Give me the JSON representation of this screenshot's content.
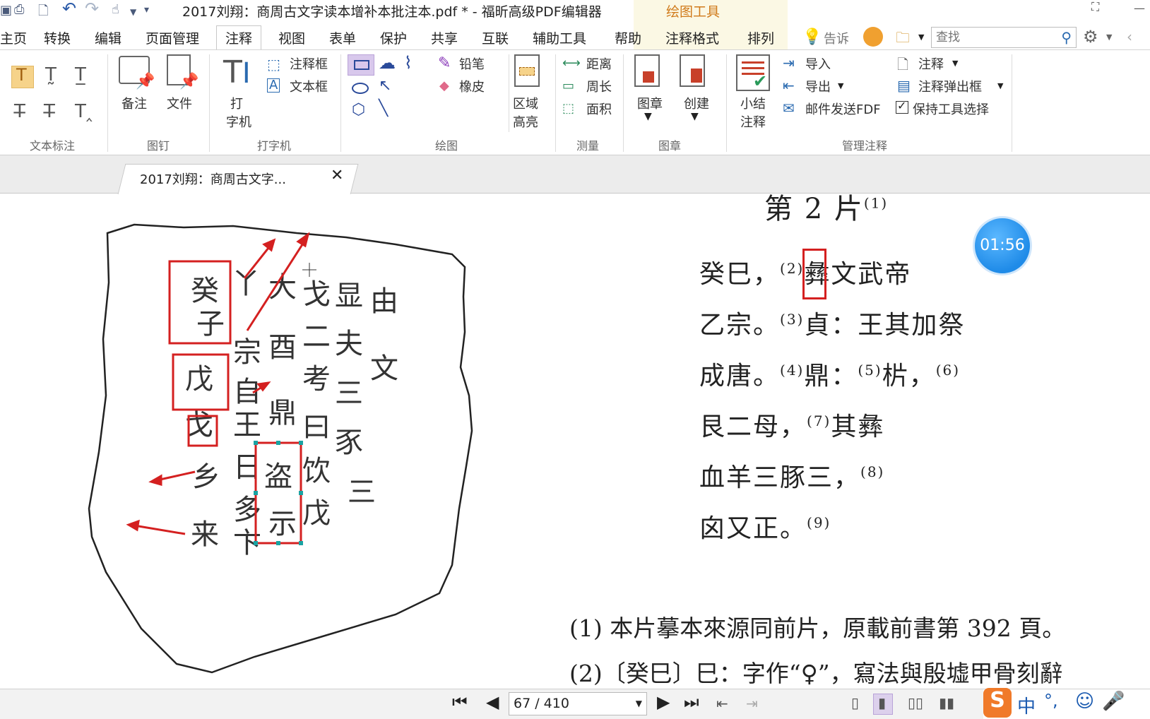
{
  "window": {
    "title": "2017刘翔：商周古文字读本增补本批注本.pdf * - 福昕高级PDF编辑器",
    "contextual_tab": "绘图工具"
  },
  "menu": {
    "tabs": [
      "主页",
      "转换",
      "编辑",
      "页面管理",
      "注释",
      "视图",
      "表单",
      "保护",
      "共享",
      "互联",
      "辅助工具",
      "帮助",
      "注释格式",
      "排列"
    ],
    "active": "注释",
    "tell_me": "告诉",
    "search_placeholder": "查找"
  },
  "ribbon": {
    "groups": {
      "text_markup": "文本标注",
      "pin": "图钉",
      "typewriter": "打字机",
      "drawing": "绘图",
      "measure": "测量",
      "stamp": "图章",
      "manage": "管理注释"
    },
    "pin": {
      "note": "备注",
      "file": "文件"
    },
    "typewriter": {
      "typewriter": [
        "打",
        "字机"
      ],
      "callout": "注释框",
      "textbox": "文本框"
    },
    "drawing": {
      "pencil": "铅笔",
      "eraser": "橡皮",
      "area_highlight": [
        "区域",
        "高亮"
      ]
    },
    "measure": {
      "distance": "距离",
      "perimeter": "周长",
      "area": "面积"
    },
    "stamp": {
      "stamp": "图章",
      "create": "创建"
    },
    "manage": {
      "summarize": [
        "小结",
        "注释"
      ],
      "import": "导入",
      "export": "导出",
      "email_fdf": "邮件发送FDF",
      "annotations": "注释",
      "popup": "注释弹出框",
      "keep_tool": "保持工具选择"
    }
  },
  "doc_tab": {
    "label": "2017刘翔：商周古文字..."
  },
  "document": {
    "heading": "第 2 片",
    "heading_note": "(1)",
    "lines": [
      {
        "text_a": "癸巳，",
        "note_a": "(2)",
        "text_b": "彝文武帝"
      },
      {
        "text_a": "乙宗。",
        "note_a": "(3)",
        "text_b": "貞：王其加祭"
      },
      {
        "text_a": "成唐。",
        "note_a": "(4)",
        "text_b": "鼎：",
        "note_b": "(5)",
        "text_c": "㭊，",
        "note_c": "(6)"
      },
      {
        "text_a": "艮二母，",
        "note_a": "(7)",
        "text_b": "其彝"
      },
      {
        "text_a": "血羊三豚三，",
        "note_a": "(8)"
      },
      {
        "text_a": "囟又正。",
        "note_a": "(9)"
      }
    ],
    "footnotes": [
      "(1) 本片摹本來源同前片，原載前書第 392 頁。",
      "(2)〔癸巳〕巳：字作“♀”，寫法與殷墟甲骨刻辭"
    ]
  },
  "timer": "01:56",
  "statusbar": {
    "page_indicator": "67 / 410"
  },
  "ime": {
    "lang": "中",
    "punct": "°,"
  },
  "colors": {
    "annotation_red": "#d42020",
    "accent_blue": "#1f8be8",
    "drawing_tab_bg": "#fbf8e4",
    "drawing_tab_text": "#d07a1a"
  }
}
